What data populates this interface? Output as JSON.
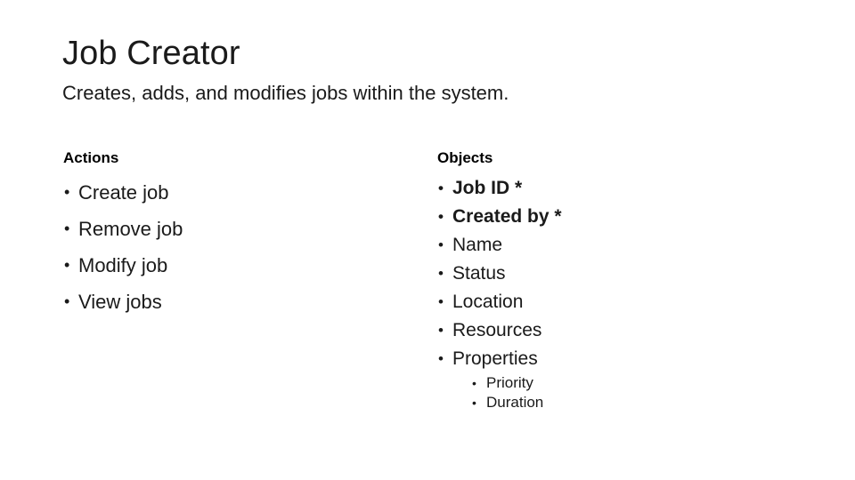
{
  "slide": {
    "title": "Job Creator",
    "subtitle": "Creates, adds, and modifies jobs within the system.",
    "background_color": "#ffffff",
    "text_color": "#1a1a1a",
    "bullet_glyph": "•"
  },
  "columns": {
    "actions": {
      "heading": "Actions",
      "items": [
        {
          "label": "Create job"
        },
        {
          "label": "Remove job"
        },
        {
          "label": "Modify job"
        },
        {
          "label": "View jobs"
        }
      ]
    },
    "objects": {
      "heading": "Objects",
      "items": [
        {
          "label": "Job ID *",
          "required": true
        },
        {
          "label": "Created by *",
          "required": true
        },
        {
          "label": "Name",
          "required": false
        },
        {
          "label": "Status",
          "required": false
        },
        {
          "label": "Location",
          "required": false
        },
        {
          "label": "Resources",
          "required": false
        },
        {
          "label": "Properties",
          "required": false
        }
      ],
      "sub_items": [
        {
          "label": "Priority"
        },
        {
          "label": "Duration"
        }
      ]
    }
  }
}
